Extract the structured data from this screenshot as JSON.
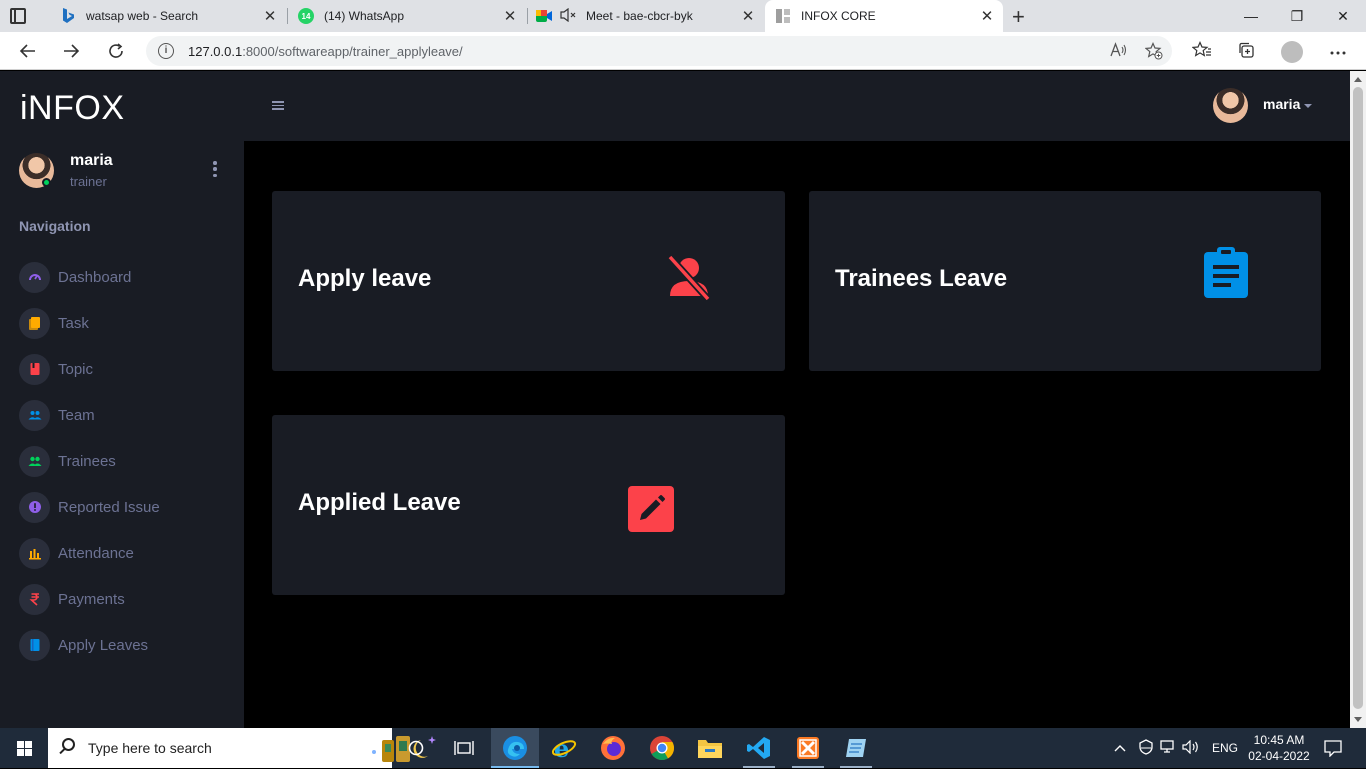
{
  "browser": {
    "tabs": [
      {
        "title": "watsap web - Search",
        "favicon": "bing-icon",
        "color": "#2f6fd6",
        "close": "✕"
      },
      {
        "title": "(14) WhatsApp",
        "favicon": "whatsapp-icon",
        "color": "#25d366",
        "badge": "14",
        "close": "✕"
      },
      {
        "title": "Meet - bae-cbcr-byk",
        "favicon": "google-meet-icon",
        "color": "#00897b",
        "muted": true,
        "close": "✕"
      },
      {
        "title": "INFOX CORE",
        "favicon": "page-icon",
        "color": "#9e9e9e",
        "close": "✕",
        "active": true
      }
    ],
    "new_tab": "+",
    "url": "127.0.0.1:8000/softwareapp/trainer_applyleave/",
    "url_host": "127.0.0.1",
    "url_rest": ":8000/softwareapp/trainer_applyleave/",
    "window_controls": {
      "minimize": "—",
      "restore": "❐",
      "close": "✕"
    }
  },
  "app": {
    "brand": "iNFOX",
    "accent": "#fc424a",
    "sidebar_bg": "#191c24",
    "user": {
      "name": "maria",
      "role": "trainer",
      "status": "online"
    },
    "nav_title": "Navigation",
    "nav_items": [
      {
        "label": "Dashboard",
        "icon": "speedometer-icon",
        "color": "#8f5fe8"
      },
      {
        "label": "Task",
        "icon": "clipboard-icon",
        "color": "#ffab00"
      },
      {
        "label": "Topic",
        "icon": "book-icon",
        "color": "#fc424a"
      },
      {
        "label": "Team",
        "icon": "people-icon",
        "color": "#0090e7"
      },
      {
        "label": "Trainees",
        "icon": "users-icon",
        "color": "#00d25b"
      },
      {
        "label": "Reported Issue",
        "icon": "alert-icon",
        "color": "#8f5fe8"
      },
      {
        "label": "Attendance",
        "icon": "bar-chart-icon",
        "color": "#ffab00"
      },
      {
        "label": "Payments",
        "icon": "rupee-icon",
        "color": "#fc424a"
      },
      {
        "label": "Apply Leaves",
        "icon": "book-blue-icon",
        "color": "#0090e7"
      }
    ],
    "topbar_user": "maria",
    "cards": [
      {
        "title": "Apply leave",
        "icon": "account-off-icon",
        "icon_color": "#fc424a"
      },
      {
        "title": "Trainees Leave",
        "icon": "clipboard-text-icon",
        "icon_color": "#0090e7"
      },
      {
        "title": "Applied Leave",
        "icon": "pencil-box-icon",
        "icon_color": "#fc424a"
      }
    ]
  },
  "taskbar": {
    "search_placeholder": "Type here to search",
    "apps": [
      "task-view-icon",
      "widgets-icon",
      "edge-icon",
      "ie-icon",
      "firefox-icon",
      "chrome-icon",
      "file-explorer-icon",
      "vscode-icon",
      "xampp-icon",
      "notepad-icon"
    ],
    "language": "ENG",
    "time": "10:45 AM",
    "date": "02-04-2022"
  }
}
